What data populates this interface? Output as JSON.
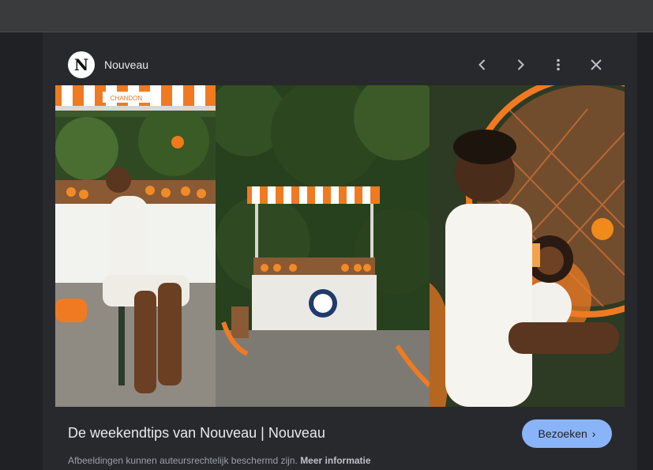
{
  "header": {
    "site_name": "Nouveau",
    "logo_letter": "N",
    "icons": [
      "chevron-left-icon",
      "chevron-right-icon",
      "more-vert-icon",
      "close-icon"
    ]
  },
  "result": {
    "title": "De weekendtips van Nouveau | Nouveau",
    "visit_label": "Bezoeken",
    "visit_chevron": "›",
    "copyright_text": "Afbeeldingen kunnen auteursrechtelijk beschermd zijn.",
    "more_info_label": "Meer informatie"
  },
  "image": {
    "awning_text": "CHANDON",
    "colors": {
      "accent": "#8ab4f8",
      "orange": "#f07a22",
      "foliage": "#2f4a23"
    }
  }
}
